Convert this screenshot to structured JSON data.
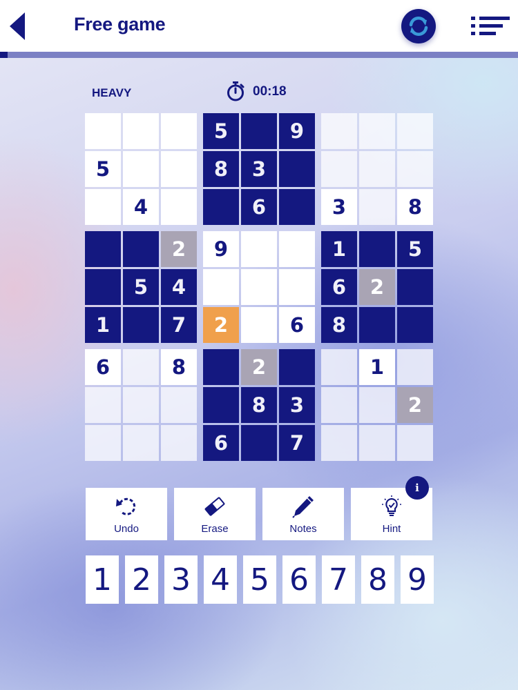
{
  "header": {
    "title": "Free game",
    "back_icon": "chevron-left-icon",
    "refresh_icon": "refresh-icon",
    "menu_icon": "list-menu-icon",
    "progress": 0.015
  },
  "status": {
    "difficulty": "HEAVY",
    "timer_icon": "stopwatch-icon",
    "time": "00:18"
  },
  "board": {
    "rows": [
      [
        "",
        "",
        "",
        "5",
        "",
        "9",
        "",
        "",
        ""
      ],
      [
        "5",
        "",
        "",
        "8",
        "3",
        "",
        "",
        "",
        ""
      ],
      [
        "",
        "4",
        "",
        "",
        "6",
        "",
        "3",
        "",
        "8"
      ],
      [
        "",
        "",
        "2",
        "9",
        "",
        "",
        "1",
        "",
        "5"
      ],
      [
        "",
        "5",
        "4",
        "",
        "",
        "",
        "6",
        "2",
        ""
      ],
      [
        "1",
        "",
        "7",
        "2",
        "",
        "6",
        "8",
        "",
        ""
      ],
      [
        "6",
        "",
        "8",
        "",
        "2",
        "",
        "",
        "1",
        ""
      ],
      [
        "",
        "",
        "",
        "",
        "8",
        "3",
        "",
        "",
        "2"
      ],
      [
        "",
        "",
        "",
        "6",
        "",
        "7",
        "",
        "",
        ""
      ]
    ],
    "styles": [
      [
        "L",
        "L",
        "L",
        "D",
        "D",
        "D",
        "G",
        "G",
        "G"
      ],
      [
        "L",
        "L",
        "L",
        "D",
        "D",
        "D",
        "G",
        "G",
        "G"
      ],
      [
        "L",
        "L",
        "L",
        "D",
        "D",
        "D",
        "L",
        "G",
        "L"
      ],
      [
        "D",
        "D",
        "H",
        "L",
        "L",
        "L",
        "D",
        "D",
        "D"
      ],
      [
        "D",
        "D",
        "D",
        "L",
        "L",
        "L",
        "D",
        "H",
        "D"
      ],
      [
        "D",
        "D",
        "D",
        "S",
        "L",
        "L",
        "D",
        "D",
        "D"
      ],
      [
        "L",
        "G",
        "L",
        "D",
        "H",
        "D",
        "G",
        "L",
        "G"
      ],
      [
        "G",
        "G",
        "G",
        "D",
        "D",
        "D",
        "G",
        "G",
        "H"
      ],
      [
        "G",
        "G",
        "G",
        "D",
        "D",
        "D",
        "G",
        "G",
        "G"
      ]
    ],
    "colors": {
      "navy": "#141880",
      "highlight": "#a9a4b4",
      "selected": "#f0a04c"
    }
  },
  "tools": [
    {
      "label": "Undo",
      "icon": "undo-icon"
    },
    {
      "label": "Erase",
      "icon": "eraser-icon"
    },
    {
      "label": "Notes",
      "icon": "pen-icon"
    },
    {
      "label": "Hint",
      "icon": "lightbulb-icon"
    }
  ],
  "hint_info": "i",
  "numpad": [
    "1",
    "2",
    "3",
    "4",
    "5",
    "6",
    "7",
    "8",
    "9"
  ]
}
